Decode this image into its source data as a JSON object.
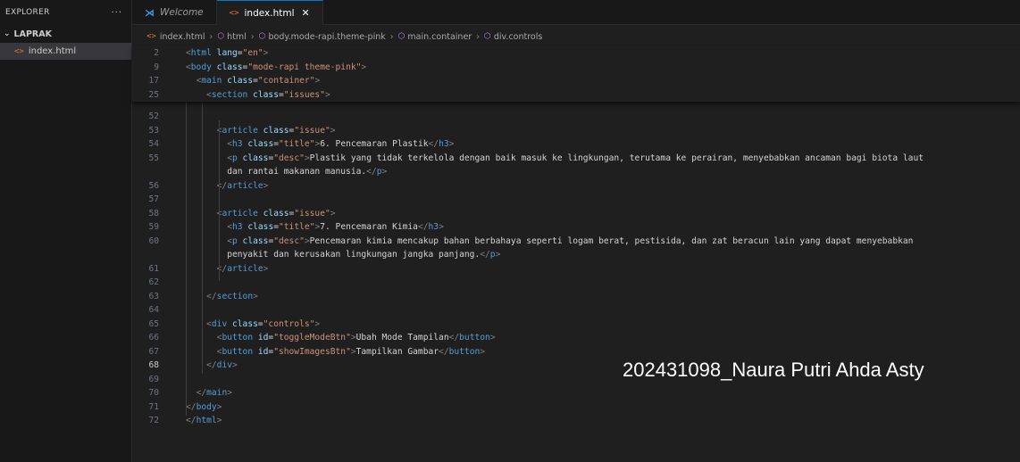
{
  "sidebar": {
    "title": "EXPLORER",
    "more": "···",
    "folder": "LAPRAK",
    "file": "index.html"
  },
  "tabs": [
    {
      "label": "Welcome",
      "icon": "vscode-icon"
    },
    {
      "label": "index.html",
      "icon": "html-file-icon",
      "close": "✕"
    }
  ],
  "breadcrumb": [
    "index.html",
    "html",
    "body.mode-rapi.theme-pink",
    "main.container",
    "div.controls"
  ],
  "editor": {
    "current_line": "68",
    "sticky_lines": [
      {
        "n": "2",
        "tokens": [
          [
            "tag",
            "<"
          ],
          [
            "tn",
            "html"
          ],
          [
            "at",
            " lang"
          ],
          [
            "tx",
            "="
          ],
          [
            "st",
            "\"en\""
          ],
          [
            "tag",
            ">"
          ]
        ]
      },
      {
        "n": "9",
        "tokens": [
          [
            "tag",
            "<"
          ],
          [
            "tn",
            "body"
          ],
          [
            "at",
            " class"
          ],
          [
            "tx",
            "="
          ],
          [
            "st",
            "\"mode-rapi theme-pink\""
          ],
          [
            "tag",
            ">"
          ]
        ]
      },
      {
        "n": "17",
        "tokens": [
          [
            "tx",
            "  "
          ],
          [
            "tag",
            "<"
          ],
          [
            "tn",
            "main"
          ],
          [
            "at",
            " class"
          ],
          [
            "tx",
            "="
          ],
          [
            "st",
            "\"container\""
          ],
          [
            "tag",
            ">"
          ]
        ]
      },
      {
        "n": "25",
        "tokens": [
          [
            "tx",
            "    "
          ],
          [
            "tag",
            "<"
          ],
          [
            "tn",
            "section"
          ],
          [
            "at",
            " class"
          ],
          [
            "tx",
            "="
          ],
          [
            "st",
            "\"issues\""
          ],
          [
            "tag",
            ">"
          ]
        ]
      }
    ],
    "lines": [
      {
        "n": "52",
        "tokens": []
      },
      {
        "n": "53",
        "tokens": [
          [
            "tx",
            "      "
          ],
          [
            "tag",
            "<"
          ],
          [
            "tn",
            "article"
          ],
          [
            "at",
            " class"
          ],
          [
            "tx",
            "="
          ],
          [
            "st",
            "\"issue\""
          ],
          [
            "tag",
            ">"
          ]
        ]
      },
      {
        "n": "54",
        "tokens": [
          [
            "tx",
            "        "
          ],
          [
            "tag",
            "<"
          ],
          [
            "tn",
            "h3"
          ],
          [
            "at",
            " class"
          ],
          [
            "tx",
            "="
          ],
          [
            "st",
            "\"title\""
          ],
          [
            "tag",
            ">"
          ],
          [
            "tx",
            "6. Pencemaran Plastik"
          ],
          [
            "tag",
            "</"
          ],
          [
            "tn",
            "h3"
          ],
          [
            "tag",
            ">"
          ]
        ]
      },
      {
        "n": "55",
        "tokens": [
          [
            "tx",
            "        "
          ],
          [
            "tag",
            "<"
          ],
          [
            "tn",
            "p"
          ],
          [
            "at",
            " class"
          ],
          [
            "tx",
            "="
          ],
          [
            "st",
            "\"desc\""
          ],
          [
            "tag",
            ">"
          ],
          [
            "tx",
            "Plastik yang tidak terkelola dengan baik masuk ke lingkungan, terutama ke perairan, menyebabkan ancaman bagi biota laut"
          ]
        ]
      },
      {
        "n": "",
        "tokens": [
          [
            "tx",
            "        dan rantai makanan manusia."
          ],
          [
            "tag",
            "</"
          ],
          [
            "tn",
            "p"
          ],
          [
            "tag",
            ">"
          ]
        ]
      },
      {
        "n": "56",
        "tokens": [
          [
            "tx",
            "      "
          ],
          [
            "tag",
            "</"
          ],
          [
            "tn",
            "article"
          ],
          [
            "tag",
            ">"
          ]
        ]
      },
      {
        "n": "57",
        "tokens": []
      },
      {
        "n": "58",
        "tokens": [
          [
            "tx",
            "      "
          ],
          [
            "tag",
            "<"
          ],
          [
            "tn",
            "article"
          ],
          [
            "at",
            " class"
          ],
          [
            "tx",
            "="
          ],
          [
            "st",
            "\"issue\""
          ],
          [
            "tag",
            ">"
          ]
        ]
      },
      {
        "n": "59",
        "tokens": [
          [
            "tx",
            "        "
          ],
          [
            "tag",
            "<"
          ],
          [
            "tn",
            "h3"
          ],
          [
            "at",
            " class"
          ],
          [
            "tx",
            "="
          ],
          [
            "st",
            "\"title\""
          ],
          [
            "tag",
            ">"
          ],
          [
            "tx",
            "7. Pencemaran Kimia"
          ],
          [
            "tag",
            "</"
          ],
          [
            "tn",
            "h3"
          ],
          [
            "tag",
            ">"
          ]
        ]
      },
      {
        "n": "60",
        "tokens": [
          [
            "tx",
            "        "
          ],
          [
            "tag",
            "<"
          ],
          [
            "tn",
            "p"
          ],
          [
            "at",
            " class"
          ],
          [
            "tx",
            "="
          ],
          [
            "st",
            "\"desc\""
          ],
          [
            "tag",
            ">"
          ],
          [
            "tx",
            "Pencemaran kimia mencakup bahan berbahaya seperti logam berat, pestisida, dan zat beracun lain yang dapat menyebabkan"
          ]
        ]
      },
      {
        "n": "",
        "tokens": [
          [
            "tx",
            "        penyakit dan kerusakan lingkungan jangka panjang."
          ],
          [
            "tag",
            "</"
          ],
          [
            "tn",
            "p"
          ],
          [
            "tag",
            ">"
          ]
        ]
      },
      {
        "n": "61",
        "tokens": [
          [
            "tx",
            "      "
          ],
          [
            "tag",
            "</"
          ],
          [
            "tn",
            "article"
          ],
          [
            "tag",
            ">"
          ]
        ]
      },
      {
        "n": "62",
        "tokens": []
      },
      {
        "n": "63",
        "tokens": [
          [
            "tx",
            "    "
          ],
          [
            "tag",
            "</"
          ],
          [
            "tn",
            "section"
          ],
          [
            "tag",
            ">"
          ]
        ]
      },
      {
        "n": "64",
        "tokens": []
      },
      {
        "n": "65",
        "tokens": [
          [
            "tx",
            "    "
          ],
          [
            "tag",
            "<"
          ],
          [
            "tn",
            "div"
          ],
          [
            "at",
            " class"
          ],
          [
            "tx",
            "="
          ],
          [
            "st",
            "\"controls\""
          ],
          [
            "tag",
            ">"
          ]
        ]
      },
      {
        "n": "66",
        "tokens": [
          [
            "tx",
            "      "
          ],
          [
            "tag",
            "<"
          ],
          [
            "tn",
            "button"
          ],
          [
            "at",
            " id"
          ],
          [
            "tx",
            "="
          ],
          [
            "st",
            "\"toggleModeBtn\""
          ],
          [
            "tag",
            ">"
          ],
          [
            "tx",
            "Ubah Mode Tampilan"
          ],
          [
            "tag",
            "</"
          ],
          [
            "tn",
            "button"
          ],
          [
            "tag",
            ">"
          ]
        ]
      },
      {
        "n": "67",
        "tokens": [
          [
            "tx",
            "      "
          ],
          [
            "tag",
            "<"
          ],
          [
            "tn",
            "button"
          ],
          [
            "at",
            " id"
          ],
          [
            "tx",
            "="
          ],
          [
            "st",
            "\"showImagesBtn\""
          ],
          [
            "tag",
            ">"
          ],
          [
            "tx",
            "Tampilkan Gambar"
          ],
          [
            "tag",
            "</"
          ],
          [
            "tn",
            "button"
          ],
          [
            "tag",
            ">"
          ]
        ]
      },
      {
        "n": "68",
        "tokens": [
          [
            "tx",
            "    "
          ],
          [
            "tag",
            "</"
          ],
          [
            "tn",
            "div"
          ],
          [
            "tag",
            ">"
          ]
        ]
      },
      {
        "n": "69",
        "tokens": []
      },
      {
        "n": "70",
        "tokens": [
          [
            "tx",
            "  "
          ],
          [
            "tag",
            "</"
          ],
          [
            "tn",
            "main"
          ],
          [
            "tag",
            ">"
          ]
        ]
      },
      {
        "n": "71",
        "tokens": [
          [
            "tag",
            "</"
          ],
          [
            "tn",
            "body"
          ],
          [
            "tag",
            ">"
          ]
        ]
      },
      {
        "n": "72",
        "tokens": [
          [
            "tag",
            "</"
          ],
          [
            "tn",
            "html"
          ],
          [
            "tag",
            ">"
          ]
        ]
      }
    ]
  },
  "watermark": "202431098_Naura Putri Ahda Asty"
}
